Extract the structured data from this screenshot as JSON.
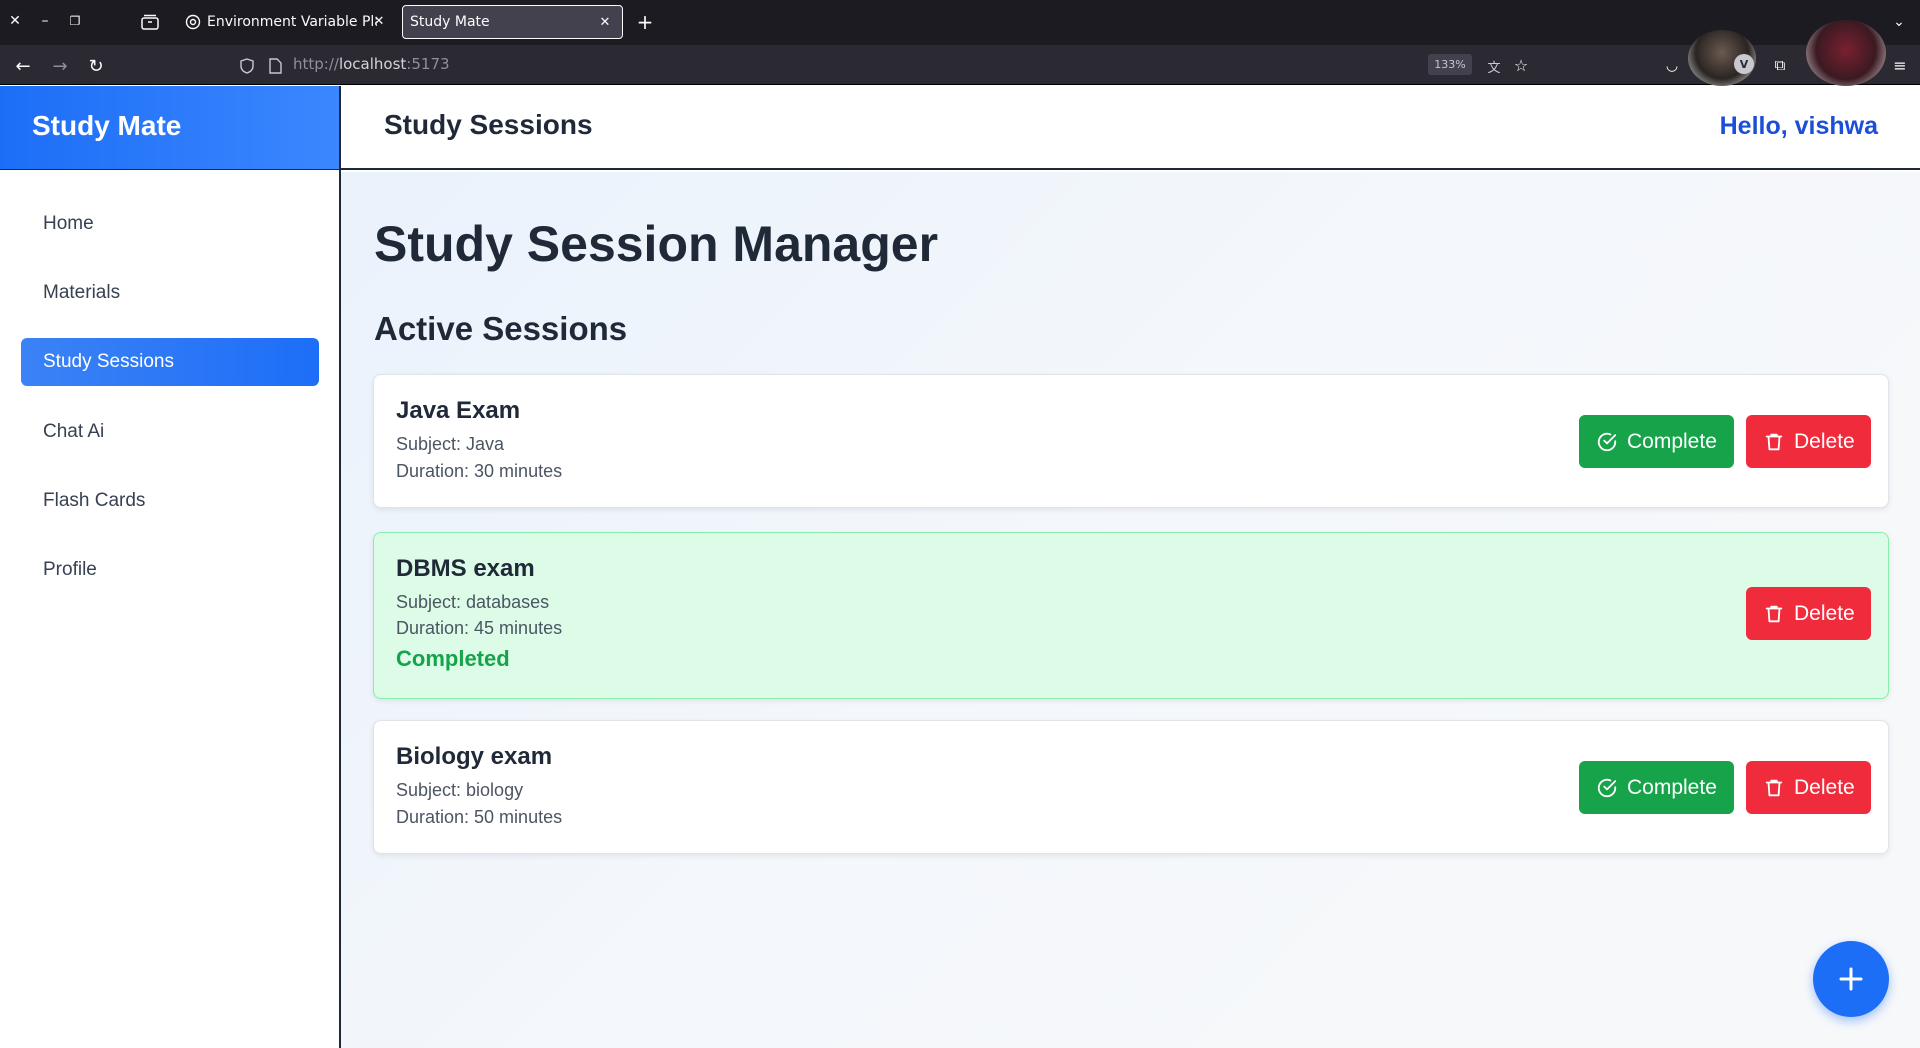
{
  "browser": {
    "tabs": [
      {
        "title": "Environment Variable Pla",
        "active": false
      },
      {
        "title": "Study Mate",
        "active": true
      }
    ],
    "url": {
      "scheme": "http://",
      "host": "localhost",
      "port": ":5173"
    },
    "zoom": "133%"
  },
  "app": {
    "brand": "Study Mate",
    "header_title": "Study Sessions",
    "greeting": "Hello, vishwa",
    "nav": [
      {
        "label": "Home",
        "active": false
      },
      {
        "label": "Materials",
        "active": false
      },
      {
        "label": "Study Sessions",
        "active": true
      },
      {
        "label": "Chat Ai",
        "active": false
      },
      {
        "label": "Flash Cards",
        "active": false
      },
      {
        "label": "Profile",
        "active": false
      }
    ]
  },
  "main": {
    "page_title": "Study Session Manager",
    "section_title": "Active Sessions",
    "sessions": [
      {
        "title": "Java Exam",
        "subject": "Subject: Java",
        "duration": "Duration: 30 minutes",
        "completed": false,
        "status": ""
      },
      {
        "title": "DBMS exam",
        "subject": "Subject: databases",
        "duration": "Duration: 45 minutes",
        "completed": true,
        "status": "Completed"
      },
      {
        "title": "Biology exam",
        "subject": "Subject: biology",
        "duration": "Duration: 50 minutes",
        "completed": false,
        "status": ""
      }
    ],
    "complete_label": "Complete",
    "delete_label": "Delete"
  },
  "colors": {
    "primary": "#1d6ef7",
    "success": "#16a34a",
    "danger": "#ef2b3c",
    "completed_bg": "#dcfce7",
    "greeting": "#1d4ed8"
  },
  "icons": {
    "complete": "check-circle-icon",
    "delete": "trash-icon",
    "fab": "plus-icon"
  }
}
